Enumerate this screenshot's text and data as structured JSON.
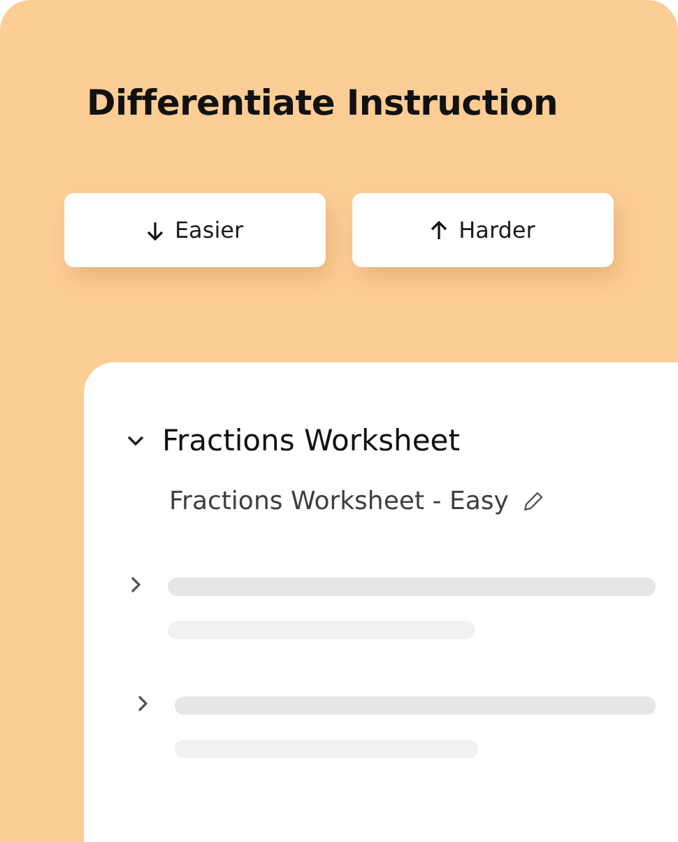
{
  "title": "Differentiate Instruction",
  "buttons": [
    {
      "label": "Easier",
      "kind": "down"
    },
    {
      "label": "Harder",
      "kind": "up"
    }
  ],
  "tree": [
    {
      "kind": "item",
      "label": "Fractions Worksheet",
      "expanded": true,
      "children": [
        {
          "label": "Fractions Worksheet - Easy",
          "kind": "editable"
        }
      ]
    },
    {
      "kind": "placeholder",
      "expanded": false
    },
    {
      "kind": "placeholder",
      "expanded": false
    }
  ]
}
